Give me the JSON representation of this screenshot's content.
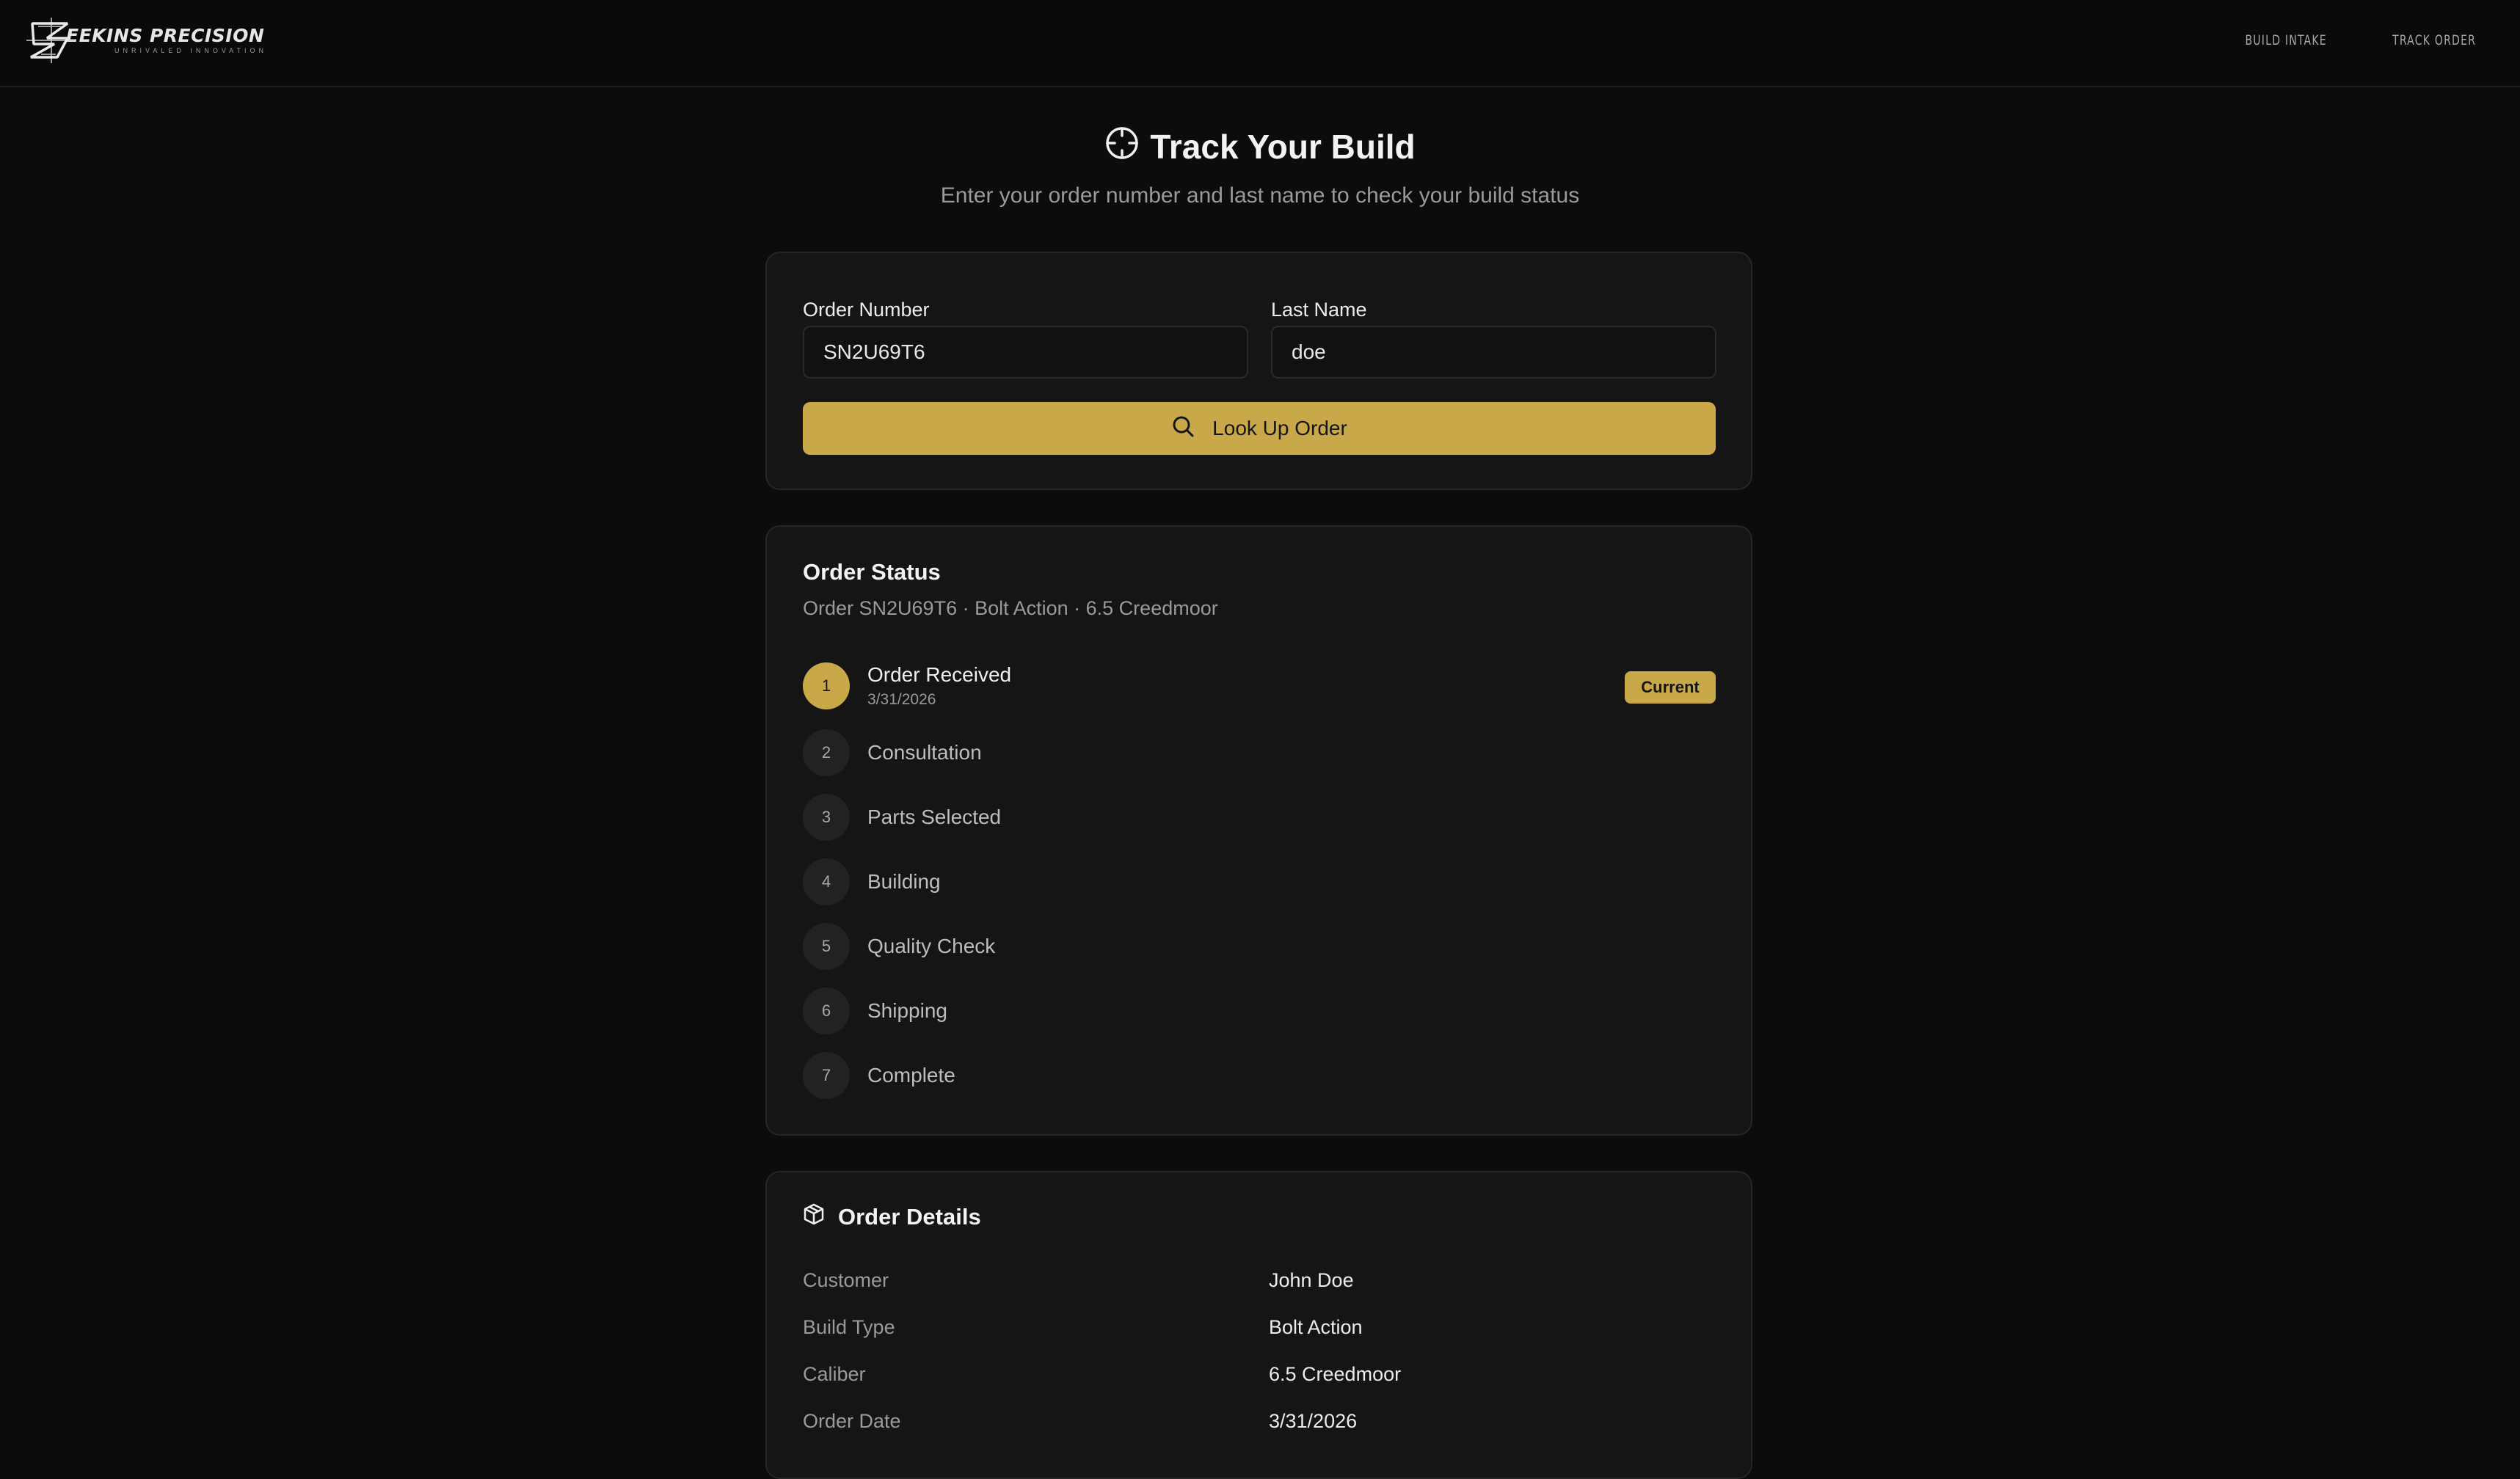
{
  "brand": {
    "name": "EEKINS PRECISION",
    "tagline": "UNRIVALED INNOVATION"
  },
  "nav": {
    "items": [
      {
        "label": "BUILD INTAKE"
      },
      {
        "label": "TRACK ORDER"
      }
    ]
  },
  "page": {
    "title": "Track Your Build",
    "title_icon": "crosshair-icon",
    "subtitle": "Enter your order number and last name to check your build status"
  },
  "lookup": {
    "order_label": "Order Number",
    "order_value": "SN2U69T6",
    "lastname_label": "Last Name",
    "lastname_value": "doe",
    "button_label": "Look Up Order",
    "button_icon": "search-icon"
  },
  "status": {
    "title": "Order Status",
    "subtitle": "Order SN2U69T6 · Bolt Action · 6.5 Creedmoor",
    "current_badge": "Current",
    "steps": [
      {
        "num": "1",
        "label": "Order Received",
        "date": "3/31/2026"
      },
      {
        "num": "2",
        "label": "Consultation"
      },
      {
        "num": "3",
        "label": "Parts Selected"
      },
      {
        "num": "4",
        "label": "Building"
      },
      {
        "num": "5",
        "label": "Quality Check"
      },
      {
        "num": "6",
        "label": "Shipping"
      },
      {
        "num": "7",
        "label": "Complete"
      }
    ]
  },
  "details": {
    "title": "Order Details",
    "title_icon": "package-icon",
    "rows": [
      {
        "key": "Customer",
        "value": "John Doe"
      },
      {
        "key": "Build Type",
        "value": "Bolt Action"
      },
      {
        "key": "Caliber",
        "value": "6.5 Creedmoor"
      },
      {
        "key": "Order Date",
        "value": "3/31/2026"
      }
    ]
  },
  "colors": {
    "accent": "#c9a84a",
    "background": "#0c0c0c",
    "card": "#151515"
  }
}
